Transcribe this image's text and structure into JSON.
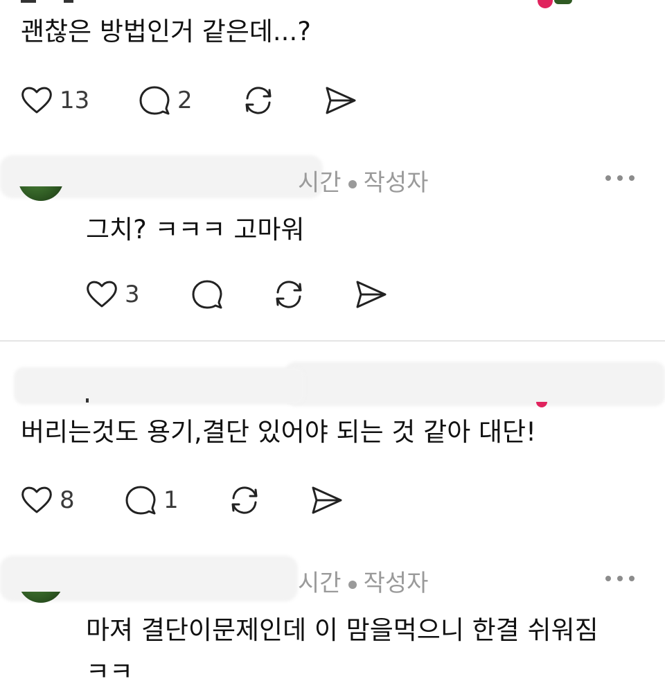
{
  "comments": [
    {
      "id": "c1",
      "text": "괜찮은 방법인거 같은데...?",
      "likes": "13",
      "replies": "2"
    },
    {
      "id": "c2",
      "meta_time": "시간",
      "meta_role": "작성자",
      "text": "그치? ㅋㅋㅋ 고마워",
      "likes": "3",
      "replies": ""
    },
    {
      "id": "c3",
      "text": "버리는것도 용기,결단  있어야 되는 것 같아 대단!",
      "likes": "8",
      "replies": "1"
    },
    {
      "id": "c4",
      "meta_time": "시간",
      "meta_role": "작성자",
      "text_line1": "마져 결단이문제인데 이 맘을먹으니 한결 쉬워짐",
      "text_line2": "ㅋㅋ"
    }
  ],
  "icons": {
    "like": "heart-icon",
    "reply": "speech-bubble-icon",
    "repost": "repost-icon",
    "share": "send-icon",
    "more": "more-dots-icon"
  },
  "colors": {
    "text": "#111111",
    "muted": "#9a9a9a",
    "icon": "#222222",
    "divider": "#e4e4e4",
    "accent": "#e0245e"
  }
}
